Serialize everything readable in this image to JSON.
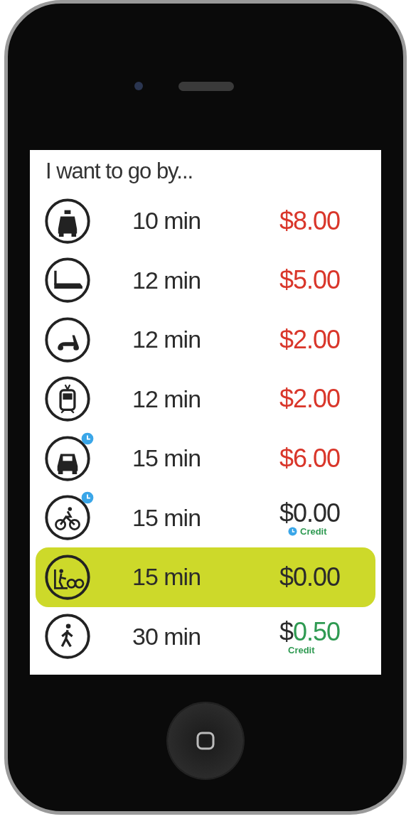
{
  "screen": {
    "heading": "I want to go by...",
    "options": [
      {
        "kind": "taxi",
        "badge": false,
        "time": "10 min",
        "symbol": {
          "text": "$",
          "color": "#d9362a"
        },
        "amount": {
          "text": "8.00",
          "color": "#d9362a"
        },
        "selected": false
      },
      {
        "kind": "limousine",
        "badge": false,
        "time": "12 min",
        "symbol": {
          "text": "$",
          "color": "#d9362a"
        },
        "amount": {
          "text": "5.00",
          "color": "#d9362a"
        },
        "selected": false
      },
      {
        "kind": "scooter",
        "badge": false,
        "time": "12 min",
        "symbol": {
          "text": "$",
          "color": "#d9362a"
        },
        "amount": {
          "text": "2.00",
          "color": "#d9362a"
        },
        "selected": false
      },
      {
        "kind": "tram",
        "badge": false,
        "time": "12 min",
        "symbol": {
          "text": "$",
          "color": "#d9362a"
        },
        "amount": {
          "text": "2.00",
          "color": "#d9362a"
        },
        "selected": false
      },
      {
        "kind": "car",
        "badge": true,
        "time": "15 min",
        "symbol": {
          "text": "$",
          "color": "#d9362a"
        },
        "amount": {
          "text": "6.00",
          "color": "#d9362a"
        },
        "selected": false
      },
      {
        "kind": "bicycle",
        "badge": true,
        "time": "15 min",
        "symbol": {
          "text": "$",
          "color": "#2b2b2b"
        },
        "amount": {
          "text": "0.00",
          "color": "#2b2b2b"
        },
        "note": {
          "text": "Credit",
          "clock": true
        },
        "selected": false
      },
      {
        "kind": "bikeshare",
        "badge": false,
        "time": "15 min",
        "symbol": {
          "text": "$",
          "color": "#2b2b2b"
        },
        "amount": {
          "text": "0.00",
          "color": "#2b2b2b"
        },
        "selected": true
      },
      {
        "kind": "walk",
        "badge": false,
        "time": "30 min",
        "symbol": {
          "text": "$",
          "color": "#2b2b2b"
        },
        "amount": {
          "text": "0.50",
          "color": "#2f9a52"
        },
        "note": {
          "text": "Credit",
          "clock": false
        },
        "selected": false
      }
    ]
  }
}
